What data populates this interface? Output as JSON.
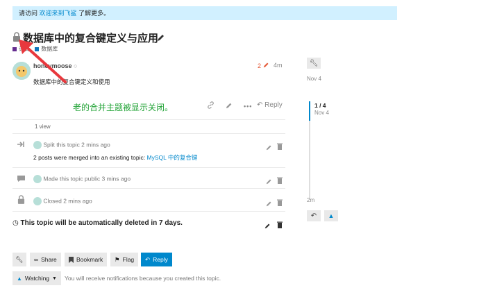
{
  "banner": {
    "prefix": "请访问",
    "link": "欢迎来到飞鲨",
    "suffix": "了解更多。"
  },
  "topic": {
    "title": "数据库中的复合键定义与应用",
    "categories": [
      {
        "name": "计算",
        "color": "#652d90"
      },
      {
        "name": "数据库",
        "color": "#0e76bd"
      }
    ]
  },
  "post": {
    "username": "honeymoose",
    "edit_count": "2",
    "time": "4m",
    "body": "数据库中的复合键定义和使用",
    "reply_label": "Reply",
    "views": "1 view"
  },
  "annotation": "老的合并主题被显示关闭。",
  "small_actions": [
    {
      "text": "Split this topic 2 mins ago"
    },
    {
      "text": "Made this topic public 3 mins ago"
    },
    {
      "text": "Closed 2 mins ago"
    }
  ],
  "merged": {
    "text": "2 posts were merged into an existing topic:",
    "link": "MySQL 中的复合键"
  },
  "deletion_notice": "This topic will be automatically deleted in 7 days.",
  "timeline": {
    "start": "Nov 4",
    "position": "1 / 4",
    "position_date": "Nov 4",
    "end": "2m"
  },
  "footer_buttons": {
    "share": "Share",
    "bookmark": "Bookmark",
    "flag": "Flag",
    "reply": "Reply"
  },
  "notifications": {
    "level": "Watching",
    "description": "You will receive notifications because you created this topic."
  },
  "colors": {
    "accent": "#0088cc",
    "annotation": "#21a336",
    "arrow": "#e8383d",
    "edit": "#e45735"
  }
}
